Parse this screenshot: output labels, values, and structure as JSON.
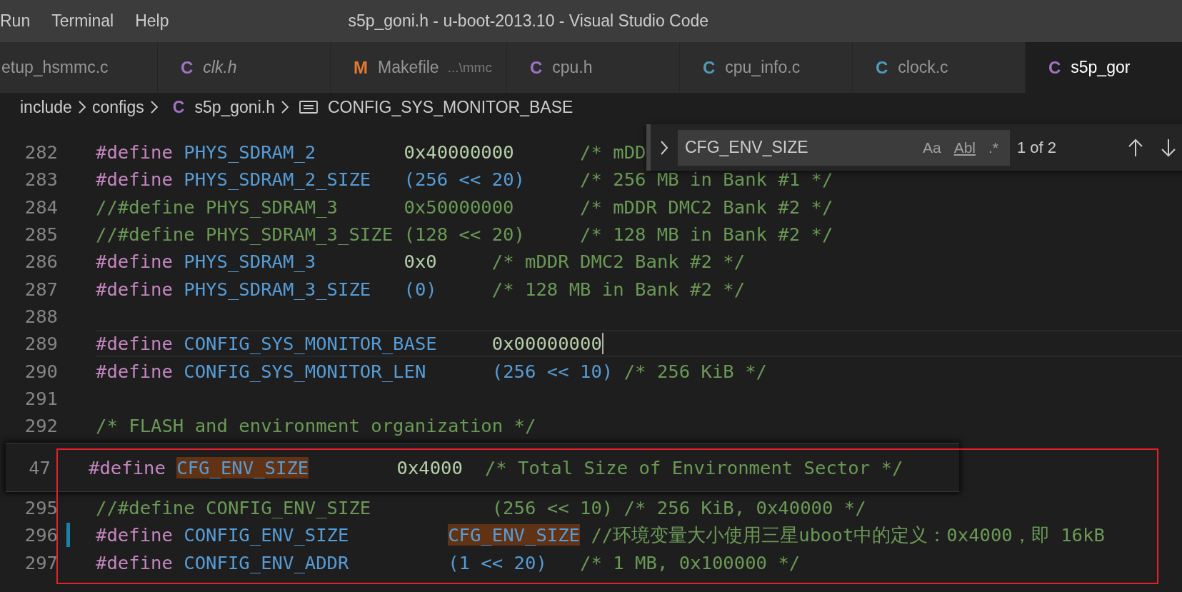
{
  "menu": [
    {
      "label": "Run"
    },
    {
      "label": "Terminal"
    },
    {
      "label": "Help"
    }
  ],
  "window": {
    "title": "s5p_goni.h - u-boot-2013.10 - Visual Studio Code"
  },
  "tabs": [
    {
      "label": "etup_hsmmc.c",
      "selected": false,
      "italic": false
    },
    {
      "label": "clk.h",
      "icon_letter": "C",
      "color": "#a074c4",
      "selected": false,
      "italic": true
    },
    {
      "label": "Makefile",
      "description": "...\\mmc",
      "icon_letter": "M",
      "color": "#e37933",
      "selected": false,
      "italic": false
    },
    {
      "label": "cpu.h",
      "icon_letter": "C",
      "color": "#a074c4",
      "selected": false,
      "italic": false
    },
    {
      "label": "cpu_info.c",
      "icon_letter": "C",
      "color": "#519aba",
      "selected": false,
      "italic": false
    },
    {
      "label": "clock.c",
      "icon_letter": "C",
      "color": "#519aba",
      "selected": false,
      "italic": false
    },
    {
      "label": "s5p_gor",
      "icon_letter": "C",
      "color": "#a074c4",
      "selected": true,
      "italic": false
    }
  ],
  "breadcrumb": [
    {
      "kind": "folder",
      "label": "include"
    },
    {
      "kind": "folder",
      "label": "configs"
    },
    {
      "kind": "file",
      "icon_letter": "C",
      "label": "s5p_goni.h"
    },
    {
      "kind": "symbol",
      "label": "CONFIG_SYS_MONITOR_BASE"
    }
  ],
  "find": {
    "query": "CFG_ENV_SIZE",
    "toggles": [
      {
        "label": "Aa",
        "on": false
      },
      {
        "label": "Abl",
        "on": false
      },
      {
        "label": ".*",
        "on": false
      }
    ],
    "result": "1 of 2"
  },
  "editor": {
    "lines": [
      {
        "number": "282",
        "current": false,
        "modified": false,
        "tokens": [
          {
            "kind": "keyword",
            "text": "#define"
          },
          {
            "kind": "macro",
            "text": " PHYS_SDRAM_2"
          },
          {
            "kind": "number",
            "text": "        0x40000000"
          },
          {
            "kind": "comment",
            "text": "      /* mDD"
          }
        ]
      },
      {
        "number": "283",
        "current": false,
        "modified": false,
        "tokens": [
          {
            "kind": "keyword",
            "text": "#define"
          },
          {
            "kind": "macro",
            "text": " PHYS_SDRAM_2_SIZE"
          },
          {
            "kind": "expr",
            "text": "   (256 << 20)"
          },
          {
            "kind": "comment",
            "text": "     /* 256 MB in Bank #1 */"
          }
        ]
      },
      {
        "number": "284",
        "current": false,
        "modified": false,
        "tokens": [
          {
            "kind": "comment",
            "text": "//#define PHYS_SDRAM_3      0x50000000      /* mDDR DMC2 Bank #2 */"
          }
        ]
      },
      {
        "number": "285",
        "current": false,
        "modified": false,
        "tokens": [
          {
            "kind": "comment",
            "text": "//#define PHYS_SDRAM_3_SIZE (128 << 20)     /* 128 MB in Bank #2 */"
          }
        ]
      },
      {
        "number": "286",
        "current": false,
        "modified": false,
        "tokens": [
          {
            "kind": "keyword",
            "text": "#define"
          },
          {
            "kind": "macro",
            "text": " PHYS_SDRAM_3"
          },
          {
            "kind": "number",
            "text": "        0x0"
          },
          {
            "kind": "comment",
            "text": "     /* mDDR DMC2 Bank #2 */"
          }
        ]
      },
      {
        "number": "287",
        "current": false,
        "modified": false,
        "tokens": [
          {
            "kind": "keyword",
            "text": "#define"
          },
          {
            "kind": "macro",
            "text": " PHYS_SDRAM_3_SIZE"
          },
          {
            "kind": "expr",
            "text": "   (0)"
          },
          {
            "kind": "comment",
            "text": "     /* 128 MB in Bank #2 */"
          }
        ]
      },
      {
        "number": "288",
        "current": false,
        "modified": false
      },
      {
        "number": "289",
        "current": true,
        "modified": false,
        "tokens": [
          {
            "kind": "keyword",
            "text": "#define"
          },
          {
            "kind": "macro",
            "text": " CONFIG_SYS_MONITOR_BASE"
          },
          {
            "kind": "number",
            "text": "     0x00000000"
          }
        ]
      },
      {
        "number": "290",
        "current": false,
        "modified": false,
        "tokens": [
          {
            "kind": "keyword",
            "text": "#define"
          },
          {
            "kind": "macro",
            "text": " CONFIG_SYS_MONITOR_LEN"
          },
          {
            "kind": "expr",
            "text": "      (256 << 10)"
          },
          {
            "kind": "comment",
            "text": " /* 256 KiB */"
          }
        ]
      },
      {
        "number": "291",
        "current": false,
        "modified": false
      },
      {
        "number": "292",
        "current": false,
        "modified": false,
        "tokens": [
          {
            "kind": "comment",
            "text": "/* FLASH and environment organization */"
          }
        ]
      },
      {
        "kind": "peek",
        "lines": [
          {
            "number": "47",
            "tokens": [
              {
                "kind": "keyword",
                "text": "#define"
              },
              {
                "kind": "macro",
                "text": " CFG_ENV_SIZE",
                "match": true
              },
              {
                "kind": "number",
                "text": "        0x4000"
              },
              {
                "kind": "comment",
                "text": "  /* Total Size of Environment Sector */"
              }
            ]
          }
        ]
      },
      {
        "number": "295",
        "current": false,
        "modified": false,
        "tokens": [
          {
            "kind": "comment",
            "text": "//#define CONFIG_ENV_SIZE           (256 << 10) /* 256 KiB, 0x40000 */"
          }
        ]
      },
      {
        "number": "296",
        "current": false,
        "modified": true,
        "tokens": [
          {
            "kind": "keyword",
            "text": "#define"
          },
          {
            "kind": "macro",
            "text": " CONFIG_ENV_SIZE"
          },
          {
            "kind": "macro",
            "text": "         CFG_ENV_SIZE",
            "match": true
          },
          {
            "kind": "comment",
            "text": " //环境变量大小使用三星uboot中的定义：0x4000，即 16kB"
          }
        ]
      },
      {
        "number": "297",
        "current": false,
        "modified": false,
        "tokens": [
          {
            "kind": "keyword",
            "text": "#define"
          },
          {
            "kind": "macro",
            "text": " CONFIG_ENV_ADDR"
          },
          {
            "kind": "expr",
            "text": "         (1 << 20)"
          },
          {
            "kind": "comment",
            "text": "   /* 1 MB, 0x100000 */"
          }
        ]
      }
    ]
  }
}
